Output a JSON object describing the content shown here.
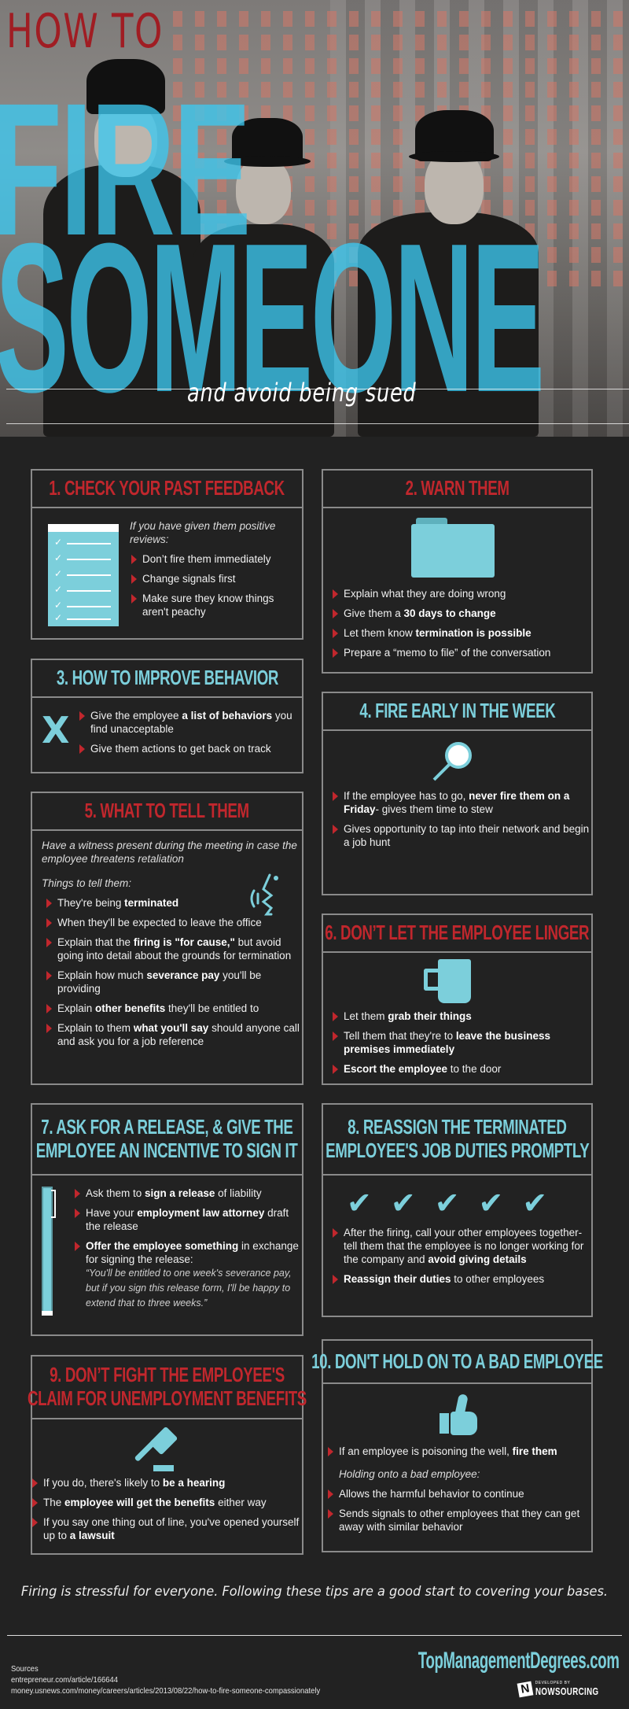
{
  "hero": {
    "line1": "HOW TO",
    "line2": "FIRE",
    "line3": "SOMEONE",
    "subtitle": "and avoid being sued"
  },
  "colors": {
    "background": "#222222",
    "red_accent": "#c1272d",
    "cyan_accent": "#7ccfdb",
    "border": "#8a8a8a"
  },
  "cards": [
    {
      "title": "1. CHECK YOUR PAST FEEDBACK",
      "title_color": "red",
      "icon": "checklist-icon",
      "intro": "If you have given them positive reviews:",
      "bullets": [
        {
          "pre": "Don’t fire them immediately",
          "bold": "",
          "post": ""
        },
        {
          "pre": "Change signals first",
          "bold": "",
          "post": ""
        },
        {
          "pre": "Make sure they know things aren't peachy",
          "bold": "",
          "post": ""
        }
      ]
    },
    {
      "title": "2. WARN THEM",
      "title_color": "red",
      "icon": "folder-icon",
      "bullets": [
        {
          "pre": "Explain what they are doing wrong",
          "bold": "",
          "post": ""
        },
        {
          "pre": "Give them a ",
          "bold": "30 days to change",
          "post": ""
        },
        {
          "pre": "Let them know ",
          "bold": "termination is possible",
          "post": ""
        },
        {
          "pre": "Prepare a “memo to file” of the conversation",
          "bold": "",
          "post": ""
        }
      ]
    },
    {
      "title": "3. HOW TO IMPROVE BEHAVIOR",
      "title_color": "blue",
      "icon": "x-icon",
      "icon_glyph": "X",
      "bullets": [
        {
          "pre": "Give the employee ",
          "bold": "a list of behaviors",
          "post": " you find unacceptable"
        },
        {
          "pre": "Give them actions to get back on track",
          "bold": "",
          "post": ""
        }
      ]
    },
    {
      "title": "4. FIRE EARLY IN THE WEEK",
      "title_color": "blue",
      "icon": "magnifier-icon",
      "bullets": [
        {
          "pre": "If the employee has to go, ",
          "bold": "never fire them on a Friday",
          "post": "- gives them time to stew"
        },
        {
          "pre": "Gives opportunity to tap into their network and begin a job hunt",
          "bold": "",
          "post": ""
        }
      ]
    },
    {
      "title": "5. WHAT TO TELL THEM",
      "title_color": "red",
      "icon": "speaking-face-icon",
      "intro": "Have a witness present during the meeting in case the employee threatens retaliation",
      "intro2": "Things to tell them:",
      "bullets": [
        {
          "pre": "They're being ",
          "bold": "terminated",
          "post": ""
        },
        {
          "pre": "When they'll be expected to leave the office",
          "bold": "",
          "post": ""
        },
        {
          "pre": "Explain that the ",
          "bold": "firing is \"for cause,\"",
          "post": " but avoid going into detail about the grounds for termination"
        },
        {
          "pre": "Explain how much ",
          "bold": "severance pay",
          "post": " you'll be providing"
        },
        {
          "pre": "Explain ",
          "bold": "other benefits",
          "post": " they'll be entitled to"
        },
        {
          "pre": "Explain to them ",
          "bold": "what you'll say",
          "post": " should anyone call and ask you for a job reference"
        }
      ]
    },
    {
      "title": "6. DON’T LET THE EMPLOYEE LINGER",
      "title_color": "red",
      "icon": "mug-icon",
      "bullets": [
        {
          "pre": "Let them ",
          "bold": "grab their things",
          "post": ""
        },
        {
          "pre": "Tell them that they're to ",
          "bold": "leave the business premises immediately",
          "post": ""
        },
        {
          "pre": "",
          "bold": "Escort the employee",
          "post": " to the door"
        }
      ]
    },
    {
      "title": "7. ASK FOR A RELEASE, & GIVE THE",
      "title_line2": "EMPLOYEE AN INCENTIVE TO SIGN IT",
      "title_color": "blue",
      "icon": "pen-icon",
      "bullets": [
        {
          "pre": "Ask them to ",
          "bold": "sign a release",
          "post": " of liability"
        },
        {
          "pre": "Have your ",
          "bold": "employment law attorney",
          "post": " draft the release"
        },
        {
          "pre": "",
          "bold": "Offer the employee something",
          "post": " in exchange for signing the release:"
        }
      ],
      "quote": "“You'll be entitled to one week's severance pay, but if you sign this release form, I'll be happy to extend that to three weeks.”"
    },
    {
      "title": "8. REASSIGN THE TERMINATED",
      "title_line2": "EMPLOYEE'S JOB DUTIES PROMPTLY",
      "title_color": "blue",
      "icon": "checkmarks-icon",
      "check_count": 5,
      "bullets": [
        {
          "pre": "After the firing, call your other employees together- tell them that the employee is no longer working for the company and ",
          "bold": "avoid giving details",
          "post": ""
        },
        {
          "pre": "",
          "bold": "Reassign their duties",
          "post": " to other employees"
        }
      ]
    },
    {
      "title": "9. DON’T FIGHT THE EMPLOYEE'S",
      "title_line2": "CLAIM FOR UNEMPLOYMENT BENEFITS",
      "title_color": "red",
      "icon": "gavel-icon",
      "bullets": [
        {
          "pre": "If you do, there's likely to ",
          "bold": "be a hearing",
          "post": ""
        },
        {
          "pre": "The ",
          "bold": "employee will get the benefits",
          "post": " either way"
        },
        {
          "pre": "If you say one thing out of line, you've opened yourself up to ",
          "bold": "a lawsuit",
          "post": ""
        }
      ]
    },
    {
      "title": "10. DON'T HOLD ON TO A BAD EMPLOYEE",
      "title_color": "blue",
      "icon": "thumbs-up-icon",
      "bullets_a": [
        {
          "pre": "If an employee is poisoning the well, ",
          "bold": "fire them",
          "post": ""
        }
      ],
      "intro": "Holding onto a bad employee:",
      "bullets": [
        {
          "pre": "Allows the harmful behavior to continue",
          "bold": "",
          "post": ""
        },
        {
          "pre": "Sends signals to other employees that they can get away with similar behavior",
          "bold": "",
          "post": ""
        }
      ]
    }
  ],
  "closing": "Firing is stressful for everyone. Following these tips are a good start to covering your bases.",
  "footer": {
    "sources_label": "Sources",
    "sources": [
      "entrepreneur.com/article/166644",
      "money.usnews.com/money/careers/articles/2013/08/22/how-to-fire-someone-compassionately"
    ],
    "brand": "TopManagementDegrees.com",
    "developed_by": "DEVELOPED BY",
    "developer": "NOWSOURCING",
    "developer_logo_letter": "N"
  }
}
